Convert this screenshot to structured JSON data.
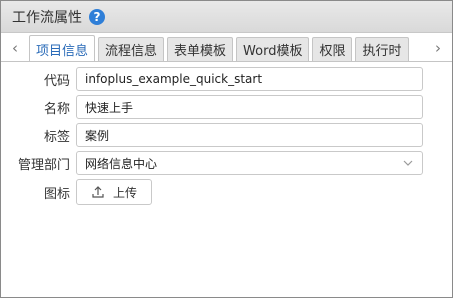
{
  "window": {
    "title": "工作流属性",
    "help_icon": "?"
  },
  "tabbar": {
    "prev": "‹",
    "next": "›",
    "tabs": [
      {
        "label": "项目信息",
        "active": true
      },
      {
        "label": "流程信息",
        "active": false
      },
      {
        "label": "表单模板",
        "active": false
      },
      {
        "label": "Word模板",
        "active": false
      },
      {
        "label": "权限",
        "active": false
      },
      {
        "label": "执行时",
        "active": false
      }
    ]
  },
  "form": {
    "code": {
      "label": "代码",
      "value": "infoplus_example_quick_start"
    },
    "name": {
      "label": "名称",
      "value": "快速上手"
    },
    "tags": {
      "label": "标签",
      "value": "案例"
    },
    "department": {
      "label": "管理部门",
      "value": "网络信息中心"
    },
    "icon": {
      "label": "图标",
      "upload_label": "上传"
    }
  },
  "colors": {
    "accent": "#2a6bb8",
    "help_icon_bg": "#2f7fd8"
  }
}
